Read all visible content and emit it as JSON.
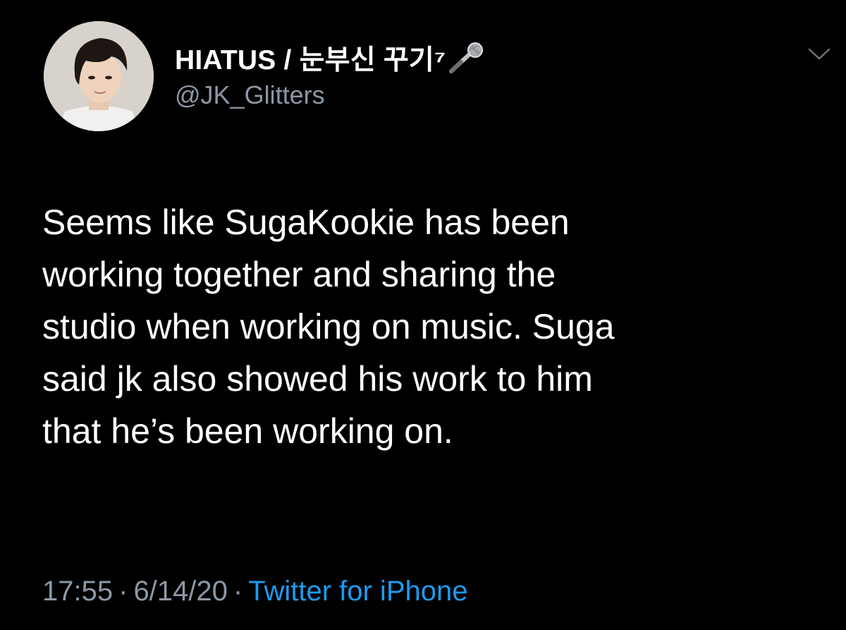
{
  "tweet": {
    "author": {
      "display_name": "HIATUS / 눈부신 꾸기⁷",
      "handle": "@JK_Glitters",
      "avatar_icon": "profile-photo",
      "name_emoji_icon": "microphone-icon"
    },
    "menu_icon": "chevron-down-icon",
    "text_lines": [
      "Seems like SugaKookie has been",
      "working together and sharing the",
      "studio when working on music. Suga",
      "said jk also showed his work to him",
      "that he’s been working on."
    ],
    "time": "17:55",
    "date": "6/14/20",
    "separator": "·",
    "source": "Twitter for iPhone"
  },
  "colors": {
    "background": "#000000",
    "primary_text": "#ffffff",
    "secondary_text": "#8b98a5",
    "link": "#1d9bf0"
  }
}
